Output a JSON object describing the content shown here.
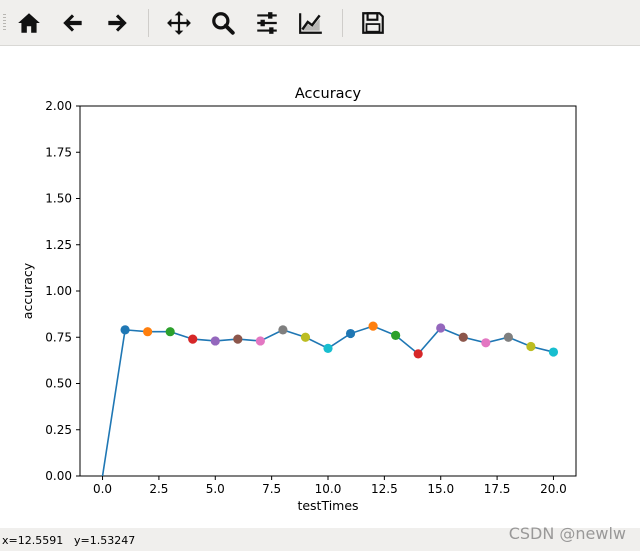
{
  "toolbar": {
    "buttons": [
      {
        "name": "home",
        "icon": "home-icon"
      },
      {
        "name": "back",
        "icon": "arrow-left-icon"
      },
      {
        "name": "forward",
        "icon": "arrow-right-icon"
      },
      {
        "name": "pan",
        "icon": "move-icon"
      },
      {
        "name": "zoom",
        "icon": "magnifier-icon"
      },
      {
        "name": "subplots",
        "icon": "sliders-icon"
      },
      {
        "name": "edit-axes",
        "icon": "chart-line-icon"
      },
      {
        "name": "save",
        "icon": "floppy-disk-icon"
      }
    ]
  },
  "chart_data": {
    "type": "line",
    "title": "Accuracy",
    "xlabel": "testTimes",
    "ylabel": "accuracy",
    "xlim": [
      -1,
      21
    ],
    "ylim": [
      0,
      2
    ],
    "xticks": [
      "0.0",
      "2.5",
      "5.0",
      "7.5",
      "10.0",
      "12.5",
      "15.0",
      "17.5",
      "20.0"
    ],
    "yticks": [
      "0.00",
      "0.25",
      "0.50",
      "0.75",
      "1.00",
      "1.25",
      "1.50",
      "1.75",
      "2.00"
    ],
    "grid": false,
    "line_color": "#1f77b4",
    "x": [
      0,
      1,
      2,
      3,
      4,
      5,
      6,
      7,
      8,
      9,
      10,
      11,
      12,
      13,
      14,
      15,
      16,
      17,
      18,
      19,
      20
    ],
    "y": [
      0.0,
      0.79,
      0.78,
      0.78,
      0.74,
      0.73,
      0.74,
      0.73,
      0.79,
      0.75,
      0.69,
      0.77,
      0.81,
      0.76,
      0.66,
      0.8,
      0.75,
      0.72,
      0.75,
      0.7,
      0.67
    ],
    "marker_colors": [
      "#1f77b4",
      "#ff7f0e",
      "#2ca02c",
      "#d62728",
      "#9467bd",
      "#8c564b",
      "#e377c2",
      "#7f7f7f",
      "#bcbd22",
      "#17becf"
    ]
  },
  "status": {
    "x_readout": "x=12.5591",
    "y_readout": "y=1.53247"
  },
  "watermark": "CSDN @newlw"
}
